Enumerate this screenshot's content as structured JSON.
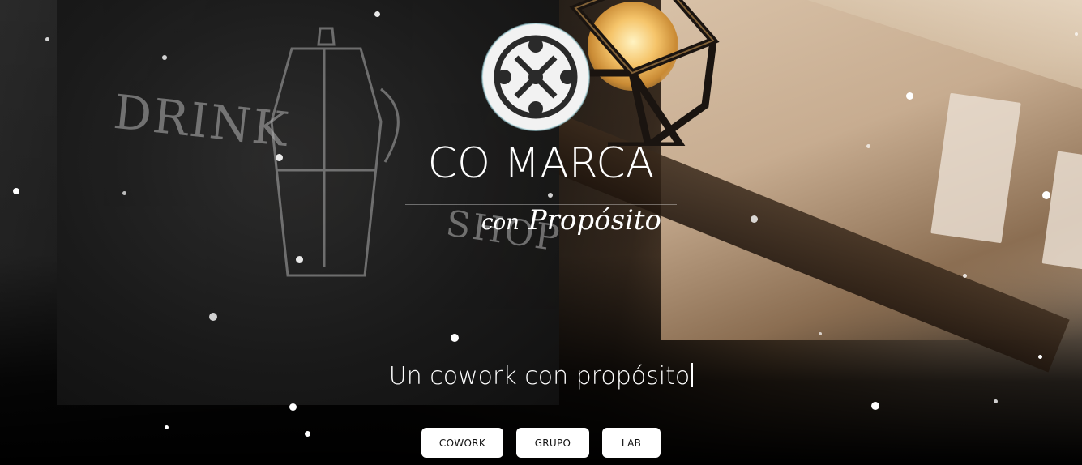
{
  "hero": {
    "brand_title": "CO MARCA",
    "brand_script_small": "con",
    "brand_script": "Propósito",
    "tagline": "Un cowork con propósito",
    "chalk_word_1": "DRINK",
    "chalk_word_2": "SHOP",
    "logo_icon": "comarca-logo-icon"
  },
  "nav_buttons": [
    {
      "label": "COWORK"
    },
    {
      "label": "GRUPO"
    },
    {
      "label": "LAB"
    }
  ],
  "colors": {
    "text": "#ffffff",
    "button_bg": "#ffffff",
    "button_text": "#111111",
    "overlay": "#000000"
  }
}
